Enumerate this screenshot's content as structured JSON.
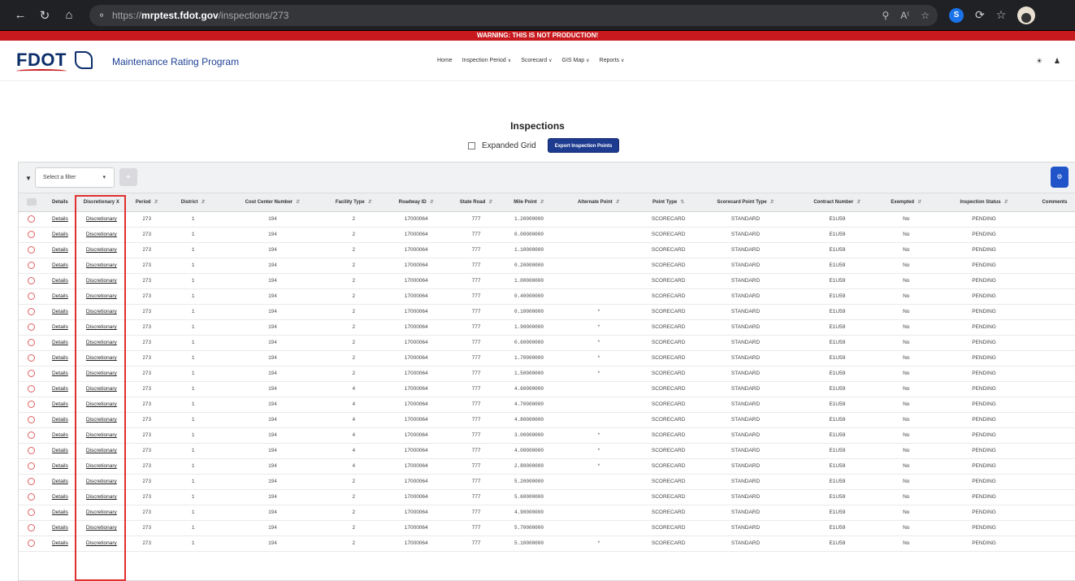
{
  "browser": {
    "url_prefix": "https://",
    "url_host": "mrptest.fdot.gov",
    "url_path": "/inspections/273"
  },
  "warning": "WARNING: THIS IS NOT PRODUCTION!",
  "app": {
    "logo_text": "FDOT",
    "title": "Maintenance Rating Program",
    "nav": {
      "home": "Home",
      "inspection_period": "Inspection Period",
      "scorecard": "Scorecard",
      "gis_map": "GIS Map",
      "reports": "Reports"
    }
  },
  "page": {
    "title": "Inspections",
    "expanded_grid_label": "Expanded Grid",
    "export_button": "Export Inspection Points"
  },
  "toolbar": {
    "filter_placeholder": "Select a filter",
    "add_symbol": "+"
  },
  "columns": [
    "Details",
    "Discretionary X",
    "Period",
    "District",
    "Cost Center Number",
    "Facility Type",
    "Roadway ID",
    "State Road",
    "Mile Point",
    "Alternate Point",
    "Point Type",
    "Scorecard Point Type",
    "Contract Number",
    "Exempted",
    "Inspection Status",
    "Comments"
  ],
  "rows": [
    {
      "details": "Details",
      "discretionary": "Discretionary",
      "period": "273",
      "district": "1",
      "cost_center": "194",
      "facility": "2",
      "roadway": "17000064",
      "state_road": "777",
      "mile_point": "1.20000000",
      "alternate": "",
      "point_type": "SCORECARD",
      "scorecard_type": "STANDARD",
      "contract": "E1U59",
      "exempted": "No",
      "status": "PENDING"
    },
    {
      "details": "Details",
      "discretionary": "Discretionary",
      "period": "273",
      "district": "1",
      "cost_center": "194",
      "facility": "2",
      "roadway": "17000064",
      "state_road": "777",
      "mile_point": "0.00000000",
      "alternate": "",
      "point_type": "SCORECARD",
      "scorecard_type": "STANDARD",
      "contract": "E1U59",
      "exempted": "No",
      "status": "PENDING"
    },
    {
      "details": "Details",
      "discretionary": "Discretionary",
      "period": "273",
      "district": "1",
      "cost_center": "194",
      "facility": "2",
      "roadway": "17000064",
      "state_road": "777",
      "mile_point": "1.10000000",
      "alternate": "",
      "point_type": "SCORECARD",
      "scorecard_type": "STANDARD",
      "contract": "E1U59",
      "exempted": "No",
      "status": "PENDING"
    },
    {
      "details": "Details",
      "discretionary": "Discretionary",
      "period": "273",
      "district": "1",
      "cost_center": "194",
      "facility": "2",
      "roadway": "17000064",
      "state_road": "777",
      "mile_point": "0.20000000",
      "alternate": "",
      "point_type": "SCORECARD",
      "scorecard_type": "STANDARD",
      "contract": "E1U59",
      "exempted": "No",
      "status": "PENDING"
    },
    {
      "details": "Details",
      "discretionary": "Discretionary",
      "period": "273",
      "district": "1",
      "cost_center": "194",
      "facility": "2",
      "roadway": "17000064",
      "state_road": "777",
      "mile_point": "1.00000000",
      "alternate": "",
      "point_type": "SCORECARD",
      "scorecard_type": "STANDARD",
      "contract": "E1U59",
      "exempted": "No",
      "status": "PENDING"
    },
    {
      "details": "Details",
      "discretionary": "Discretionary",
      "period": "273",
      "district": "1",
      "cost_center": "194",
      "facility": "2",
      "roadway": "17000064",
      "state_road": "777",
      "mile_point": "0.40000000",
      "alternate": "",
      "point_type": "SCORECARD",
      "scorecard_type": "STANDARD",
      "contract": "E1U59",
      "exempted": "No",
      "status": "PENDING"
    },
    {
      "details": "Details",
      "discretionary": "Discretionary",
      "period": "273",
      "district": "1",
      "cost_center": "194",
      "facility": "2",
      "roadway": "17000064",
      "state_road": "777",
      "mile_point": "0.10000000",
      "alternate": "*",
      "point_type": "SCORECARD",
      "scorecard_type": "STANDARD",
      "contract": "E1U59",
      "exempted": "No",
      "status": "PENDING"
    },
    {
      "details": "Details",
      "discretionary": "Discretionary",
      "period": "273",
      "district": "1",
      "cost_center": "194",
      "facility": "2",
      "roadway": "17000064",
      "state_road": "777",
      "mile_point": "1.90000000",
      "alternate": "*",
      "point_type": "SCORECARD",
      "scorecard_type": "STANDARD",
      "contract": "E1U59",
      "exempted": "No",
      "status": "PENDING"
    },
    {
      "details": "Details",
      "discretionary": "Discretionary",
      "period": "273",
      "district": "1",
      "cost_center": "194",
      "facility": "2",
      "roadway": "17000064",
      "state_road": "777",
      "mile_point": "0.60000000",
      "alternate": "*",
      "point_type": "SCORECARD",
      "scorecard_type": "STANDARD",
      "contract": "E1U59",
      "exempted": "No",
      "status": "PENDING"
    },
    {
      "details": "Details",
      "discretionary": "Discretionary",
      "period": "273",
      "district": "1",
      "cost_center": "194",
      "facility": "2",
      "roadway": "17000064",
      "state_road": "777",
      "mile_point": "1.70000000",
      "alternate": "*",
      "point_type": "SCORECARD",
      "scorecard_type": "STANDARD",
      "contract": "E1U59",
      "exempted": "No",
      "status": "PENDING"
    },
    {
      "details": "Details",
      "discretionary": "Discretionary",
      "period": "273",
      "district": "1",
      "cost_center": "194",
      "facility": "2",
      "roadway": "17000064",
      "state_road": "777",
      "mile_point": "1.50000000",
      "alternate": "*",
      "point_type": "SCORECARD",
      "scorecard_type": "STANDARD",
      "contract": "E1U59",
      "exempted": "No",
      "status": "PENDING"
    },
    {
      "details": "Details",
      "discretionary": "Discretionary",
      "period": "273",
      "district": "1",
      "cost_center": "194",
      "facility": "4",
      "roadway": "17000064",
      "state_road": "777",
      "mile_point": "4.60000000",
      "alternate": "",
      "point_type": "SCORECARD",
      "scorecard_type": "STANDARD",
      "contract": "E1U59",
      "exempted": "No",
      "status": "PENDING"
    },
    {
      "details": "Details",
      "discretionary": "Discretionary",
      "period": "273",
      "district": "1",
      "cost_center": "194",
      "facility": "4",
      "roadway": "17000064",
      "state_road": "777",
      "mile_point": "4.70000000",
      "alternate": "",
      "point_type": "SCORECARD",
      "scorecard_type": "STANDARD",
      "contract": "E1U59",
      "exempted": "No",
      "status": "PENDING"
    },
    {
      "details": "Details",
      "discretionary": "Discretionary",
      "period": "273",
      "district": "1",
      "cost_center": "194",
      "facility": "4",
      "roadway": "17000064",
      "state_road": "777",
      "mile_point": "4.80000000",
      "alternate": "",
      "point_type": "SCORECARD",
      "scorecard_type": "STANDARD",
      "contract": "E1U59",
      "exempted": "No",
      "status": "PENDING"
    },
    {
      "details": "Details",
      "discretionary": "Discretionary",
      "period": "273",
      "district": "1",
      "cost_center": "194",
      "facility": "4",
      "roadway": "17000064",
      "state_road": "777",
      "mile_point": "3.00000000",
      "alternate": "*",
      "point_type": "SCORECARD",
      "scorecard_type": "STANDARD",
      "contract": "E1U59",
      "exempted": "No",
      "status": "PENDING"
    },
    {
      "details": "Details",
      "discretionary": "Discretionary",
      "period": "273",
      "district": "1",
      "cost_center": "194",
      "facility": "4",
      "roadway": "17000064",
      "state_road": "777",
      "mile_point": "4.00000000",
      "alternate": "*",
      "point_type": "SCORECARD",
      "scorecard_type": "STANDARD",
      "contract": "E1U59",
      "exempted": "No",
      "status": "PENDING"
    },
    {
      "details": "Details",
      "discretionary": "Discretionary",
      "period": "273",
      "district": "1",
      "cost_center": "194",
      "facility": "4",
      "roadway": "17000064",
      "state_road": "777",
      "mile_point": "2.80000000",
      "alternate": "*",
      "point_type": "SCORECARD",
      "scorecard_type": "STANDARD",
      "contract": "E1U59",
      "exempted": "No",
      "status": "PENDING"
    },
    {
      "details": "Details",
      "discretionary": "Discretionary",
      "period": "273",
      "district": "1",
      "cost_center": "194",
      "facility": "2",
      "roadway": "17000064",
      "state_road": "777",
      "mile_point": "5.20000000",
      "alternate": "",
      "point_type": "SCORECARD",
      "scorecard_type": "STANDARD",
      "contract": "E1U59",
      "exempted": "No",
      "status": "PENDING"
    },
    {
      "details": "Details",
      "discretionary": "Discretionary",
      "period": "273",
      "district": "1",
      "cost_center": "194",
      "facility": "2",
      "roadway": "17000064",
      "state_road": "777",
      "mile_point": "5.60000000",
      "alternate": "",
      "point_type": "SCORECARD",
      "scorecard_type": "STANDARD",
      "contract": "E1U59",
      "exempted": "No",
      "status": "PENDING"
    },
    {
      "details": "Details",
      "discretionary": "Discretionary",
      "period": "273",
      "district": "1",
      "cost_center": "194",
      "facility": "2",
      "roadway": "17000064",
      "state_road": "777",
      "mile_point": "4.90000000",
      "alternate": "",
      "point_type": "SCORECARD",
      "scorecard_type": "STANDARD",
      "contract": "E1U59",
      "exempted": "No",
      "status": "PENDING"
    },
    {
      "details": "Details",
      "discretionary": "Discretionary",
      "period": "273",
      "district": "1",
      "cost_center": "194",
      "facility": "2",
      "roadway": "17000064",
      "state_road": "777",
      "mile_point": "5.70000000",
      "alternate": "",
      "point_type": "SCORECARD",
      "scorecard_type": "STANDARD",
      "contract": "E1U59",
      "exempted": "No",
      "status": "PENDING"
    },
    {
      "details": "Details",
      "discretionary": "Discretionary",
      "period": "273",
      "district": "1",
      "cost_center": "194",
      "facility": "2",
      "roadway": "17000064",
      "state_road": "777",
      "mile_point": "5.10000000",
      "alternate": "*",
      "point_type": "SCORECARD",
      "scorecard_type": "STANDARD",
      "contract": "E1U59",
      "exempted": "No",
      "status": "PENDING"
    }
  ]
}
